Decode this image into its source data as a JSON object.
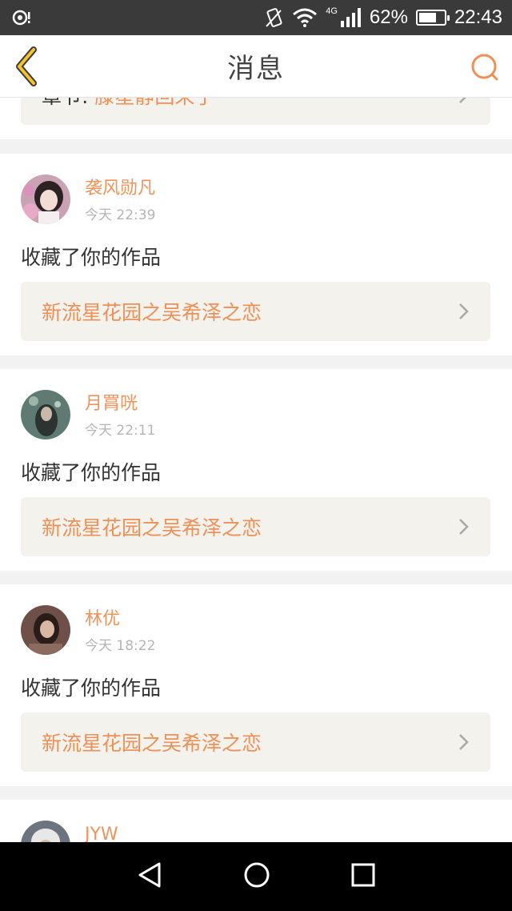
{
  "status_bar": {
    "network": "4G",
    "battery_percent": "62%",
    "battery_level": 0.62,
    "time": "22:43",
    "icons": [
      "location-icon",
      "vibrate-icon",
      "wifi-icon",
      "signal-icon",
      "battery-icon"
    ]
  },
  "header": {
    "title": "消息",
    "back_icon": "chevron-left-icon",
    "search_icon": "search-icon"
  },
  "colors": {
    "accent": "#ef9057",
    "name": "#f0935b",
    "card_bg": "#f3f2ec",
    "page_bg": "#f2f2f2"
  },
  "partial_card": {
    "prefix": "章节:",
    "highlight": "滕星静回来了"
  },
  "messages": [
    {
      "name": "袭风勋凡",
      "time": "今天 22:39",
      "action": "收藏了你的作品",
      "work": "新流星花园之吴希泽之恋"
    },
    {
      "name": "月罥咣",
      "time": "今天 22:11",
      "action": "收藏了你的作品",
      "work": "新流星花园之吴希泽之恋"
    },
    {
      "name": "林优",
      "time": "今天 18:22",
      "action": "收藏了你的作品",
      "work": "新流星花园之吴希泽之恋"
    },
    {
      "name": "JYW"
    }
  ],
  "nav": {
    "icons": [
      "back-triangle-icon",
      "home-circle-icon",
      "recents-square-icon"
    ]
  }
}
